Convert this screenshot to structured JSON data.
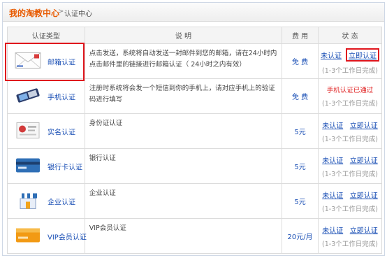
{
  "breadcrumb": {
    "home": "我的淘教中心",
    "separator": ">",
    "current": "认证中心"
  },
  "headers": {
    "type": "认证类型",
    "desc": "说 明",
    "fee": "费 用",
    "status": "状 态"
  },
  "rows": [
    {
      "icon": "mail-envelope-icon",
      "label": "邮箱认证",
      "desc": "点击发送，系统将自动发送一封邮件到您的邮箱，请在24小时内点击邮件里的链接进行邮箱认证（ 24小时之内有效）",
      "fee": "免 费",
      "status_text": "未认证",
      "action": "立即认证",
      "note": "(1-3个工作日完成)"
    },
    {
      "icon": "mobile-phone-icon",
      "label": "手机认证",
      "desc": "注册时系统将会发一个短信到你的手机上，请对应手机上的验证码进行填写",
      "fee": "免 费",
      "done_text": "手机认证已通过",
      "note": "(1-3个工作日完成)"
    },
    {
      "icon": "id-card-icon",
      "label": "实名认证",
      "desc": "身份证认证",
      "fee": "5元",
      "status_text": "未认证",
      "action": "立即认证",
      "note": "(1-3个工作日完成)"
    },
    {
      "icon": "bank-card-icon",
      "label": "银行卡认证",
      "desc": "银行认证",
      "fee": "5元",
      "status_text": "未认证",
      "action": "立即认证",
      "note": "(1-3个工作日完成)"
    },
    {
      "icon": "storefront-icon",
      "label": "企业认证",
      "desc": "企业认证",
      "fee": "5元",
      "status_text": "未认证",
      "action": "立即认证",
      "note": "(1-3个工作日完成)"
    },
    {
      "icon": "vip-card-icon",
      "label": "VIP会员认证",
      "desc": "VIP会员认证",
      "fee": "20元/月",
      "status_text": "未认证",
      "action": "立即认证",
      "note": "(1-3个工作日完成)"
    }
  ]
}
